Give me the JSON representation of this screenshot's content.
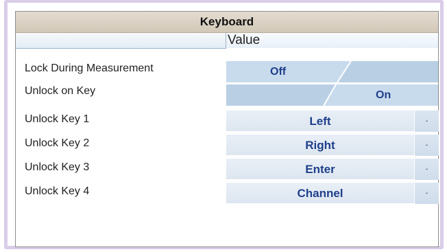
{
  "panel": {
    "title": "Keyboard",
    "value_header": "Value"
  },
  "rows": [
    {
      "label": "Lock During Measurement",
      "type": "toggle",
      "value": "Off"
    },
    {
      "label": "Unlock on Key",
      "type": "toggle",
      "value": "On"
    },
    {
      "label": "Unlock Key 1",
      "type": "select",
      "value": "Left",
      "arrow": "-"
    },
    {
      "label": "Unlock Key 2",
      "type": "select",
      "value": "Right",
      "arrow": "-"
    },
    {
      "label": "Unlock Key 3",
      "type": "select",
      "value": "Enter",
      "arrow": "-"
    },
    {
      "label": "Unlock Key 4",
      "type": "select",
      "value": "Channel",
      "arrow": "-"
    }
  ],
  "colors": {
    "frame": "#d9cde8",
    "title_bg": "#d8cfc1",
    "value_text": "#1f3f8a",
    "toggle_active": "#c6d9ec",
    "toggle_track": "#dbe7f2"
  }
}
